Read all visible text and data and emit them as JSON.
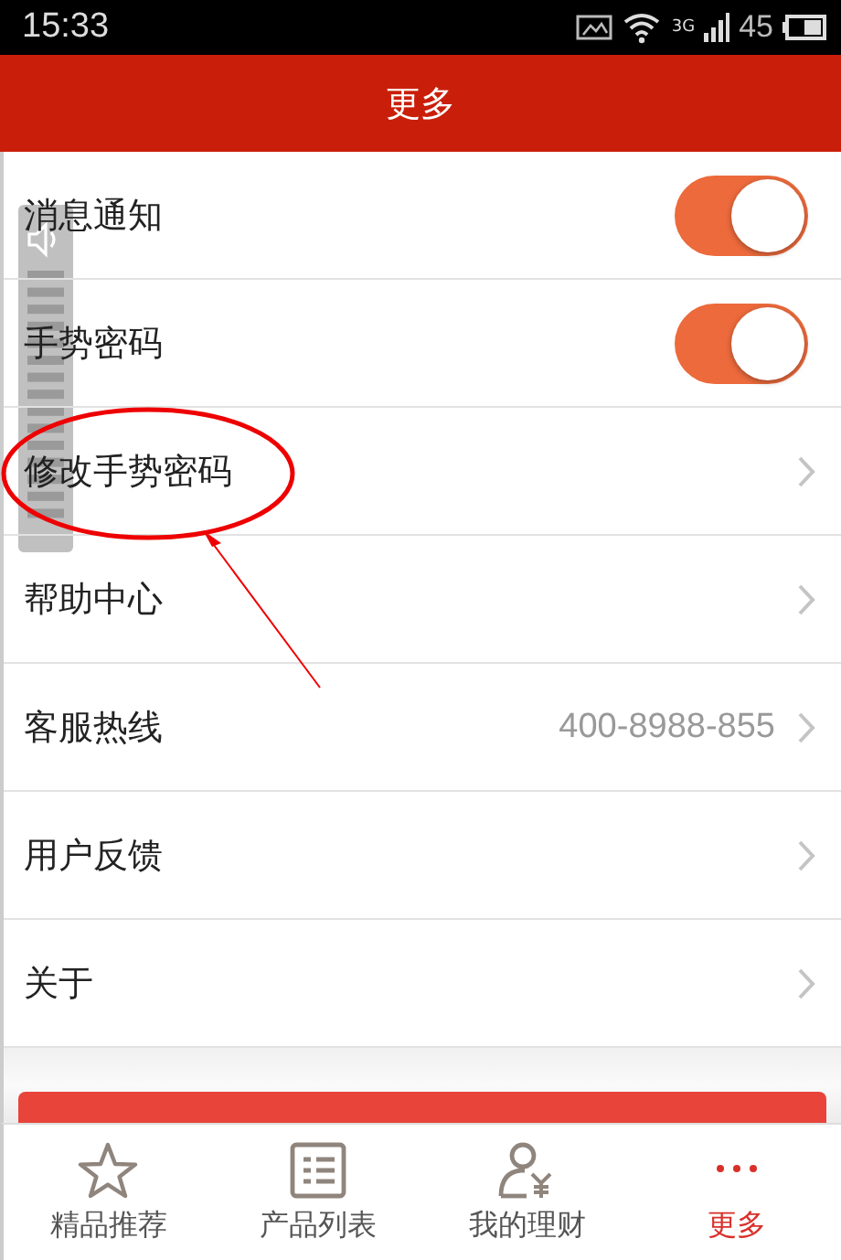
{
  "status_bar": {
    "time": "15:33",
    "network": "3G",
    "battery": "45"
  },
  "header": {
    "title": "更多"
  },
  "settings": [
    {
      "kind": "toggle",
      "label": "消息通知",
      "on": true
    },
    {
      "kind": "toggle",
      "label": "手势密码",
      "on": true
    },
    {
      "kind": "link",
      "label": "修改手势密码"
    },
    {
      "kind": "link",
      "label": "帮助中心"
    },
    {
      "kind": "link",
      "label": "客服热线",
      "value": "400-8988-855"
    },
    {
      "kind": "link",
      "label": "用户反馈"
    },
    {
      "kind": "link",
      "label": "关于"
    }
  ],
  "tabs": [
    {
      "label": "精品推荐",
      "kind": "star",
      "selected": false
    },
    {
      "label": "产品列表",
      "kind": "list",
      "selected": false
    },
    {
      "label": "我的理财",
      "kind": "user",
      "selected": false
    },
    {
      "label": "更多",
      "kind": "dots",
      "selected": true
    }
  ]
}
